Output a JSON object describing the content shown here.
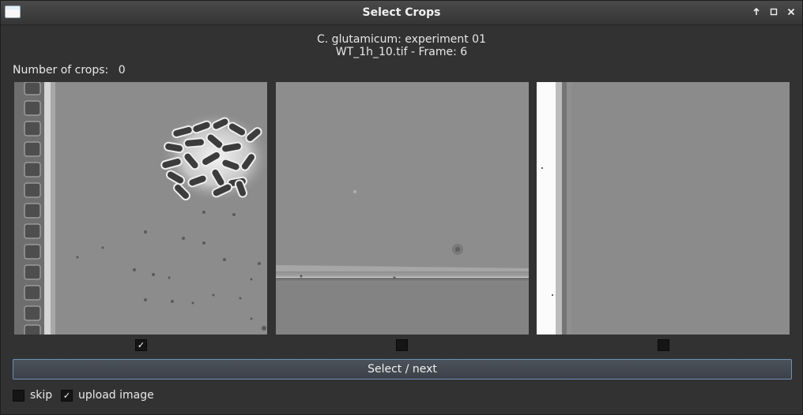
{
  "window": {
    "title": "Select Crops"
  },
  "header": {
    "line1": "C. glutamicum: experiment 01",
    "line2": "WT_1h_10.tif - Frame: 6"
  },
  "crops": {
    "count_label": "Number of crops:",
    "count_value": "0",
    "items": [
      {
        "name": "crop-1",
        "checked": true,
        "check_glyph": "✓"
      },
      {
        "name": "crop-2",
        "checked": false,
        "check_glyph": ""
      },
      {
        "name": "crop-3",
        "checked": false,
        "check_glyph": ""
      }
    ]
  },
  "actions": {
    "select_next_label": "Select / next"
  },
  "options": {
    "skip_label": "skip",
    "skip_checked": false,
    "skip_glyph": "",
    "upload_label": "upload image",
    "upload_checked": true,
    "upload_glyph": "✓"
  },
  "icons": {
    "window_controls": [
      "arrow-up-icon",
      "maximize-icon",
      "close-icon"
    ],
    "app": "app-window-icon"
  }
}
